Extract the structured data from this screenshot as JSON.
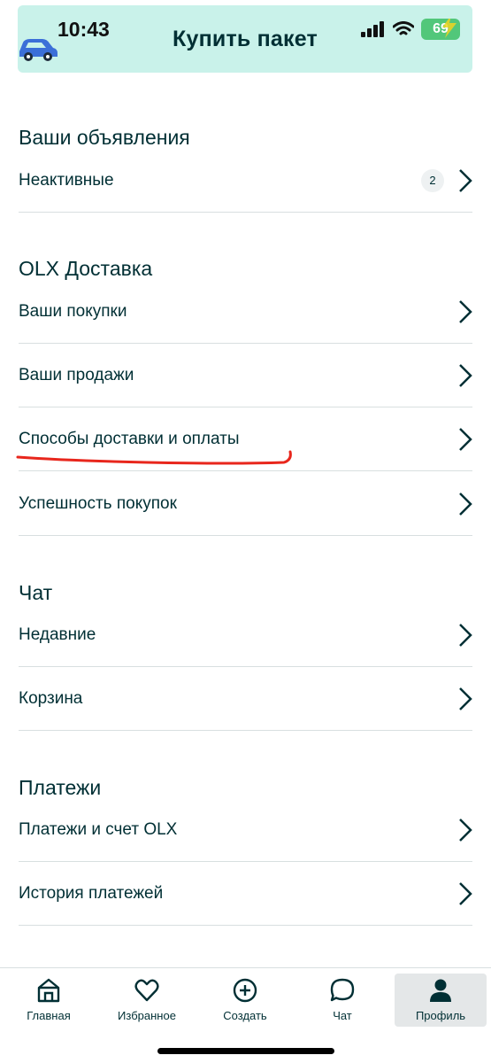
{
  "status_bar": {
    "time": "10:43",
    "battery": "69"
  },
  "banner": {
    "title": "Купить пакет"
  },
  "sections": [
    {
      "title": "Ваши объявления",
      "items": [
        {
          "label": "Неактивные",
          "count": "2"
        }
      ]
    },
    {
      "title": "OLX Доставка",
      "items": [
        {
          "label": "Ваши покупки"
        },
        {
          "label": "Ваши продажи"
        },
        {
          "label": "Способы доставки и оплаты"
        },
        {
          "label": "Успешность покупок"
        }
      ]
    },
    {
      "title": "Чат",
      "items": [
        {
          "label": "Недавние"
        },
        {
          "label": "Корзина"
        }
      ]
    },
    {
      "title": "Платежи",
      "items": [
        {
          "label": "Платежи и счет OLX"
        },
        {
          "label": "История платежей"
        }
      ]
    }
  ],
  "tabbar": {
    "tabs": [
      {
        "label": "Главная",
        "icon": "home-icon"
      },
      {
        "label": "Избранное",
        "icon": "heart-icon"
      },
      {
        "label": "Создать",
        "icon": "plus-circle-icon"
      },
      {
        "label": "Чат",
        "icon": "chat-bubble-icon"
      },
      {
        "label": "Профиль",
        "icon": "profile-icon",
        "active": true
      }
    ]
  },
  "colors": {
    "banner_bg": "#c9f2ea",
    "text": "#002f34",
    "annotation": "#e8261c"
  }
}
